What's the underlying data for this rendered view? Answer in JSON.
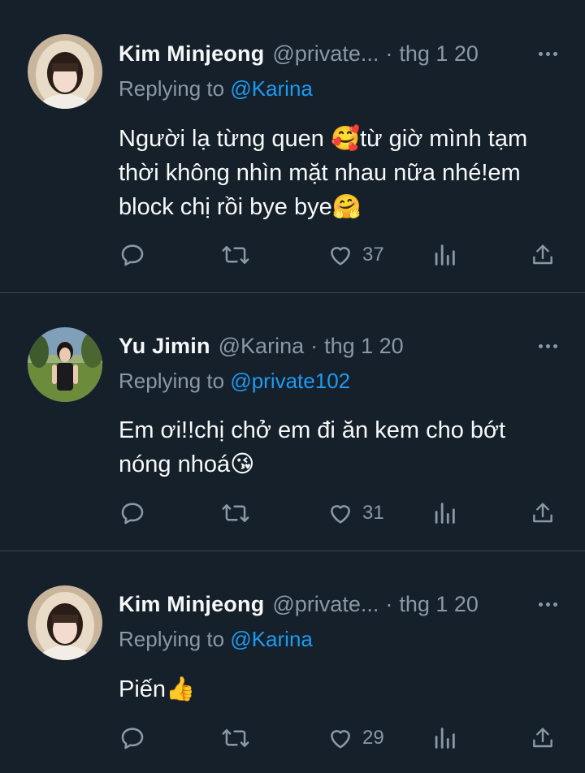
{
  "tweets": [
    {
      "name": "Kim Minjeong",
      "handle": "@private...",
      "dot": "·",
      "time": "thg 1 20",
      "reply_prefix": "Replying to",
      "reply_to": "@Karina",
      "text": "Người lạ từng quen 🥰từ giờ mình tạm thời không nhìn mặt nhau nữa nhé!em block chị rồi bye bye🤗",
      "likes": "37",
      "avatar_icon": "girl-beige-hood-avatar"
    },
    {
      "name": "Yu Jimin",
      "handle": "@Karina",
      "dot": "·",
      "time": "thg 1 20",
      "reply_prefix": "Replying to",
      "reply_to": "@private102",
      "text": "Em ơi!!chị chở em đi ăn kem cho bớt nóng nhoá😘",
      "likes": "31",
      "avatar_icon": "girl-outdoor-park-avatar"
    },
    {
      "name": "Kim Minjeong",
      "handle": "@private...",
      "dot": "·",
      "time": "thg 1 20",
      "reply_prefix": "Replying to",
      "reply_to": "@Karina",
      "text": "Piến👍",
      "likes": "29",
      "avatar_icon": "girl-beige-hood-avatar"
    }
  ],
  "icons": {
    "reply": "speech-bubble-icon",
    "retweet": "retweet-arrows-icon",
    "like": "heart-icon",
    "views": "bar-chart-icon",
    "share": "share-upload-icon",
    "more": "ellipsis-icon"
  },
  "colors": {
    "background": "#15202b",
    "text": "#f7f9f9",
    "secondary": "#8b98a5",
    "accent": "#1d9bf0",
    "divider": "#38444d"
  }
}
